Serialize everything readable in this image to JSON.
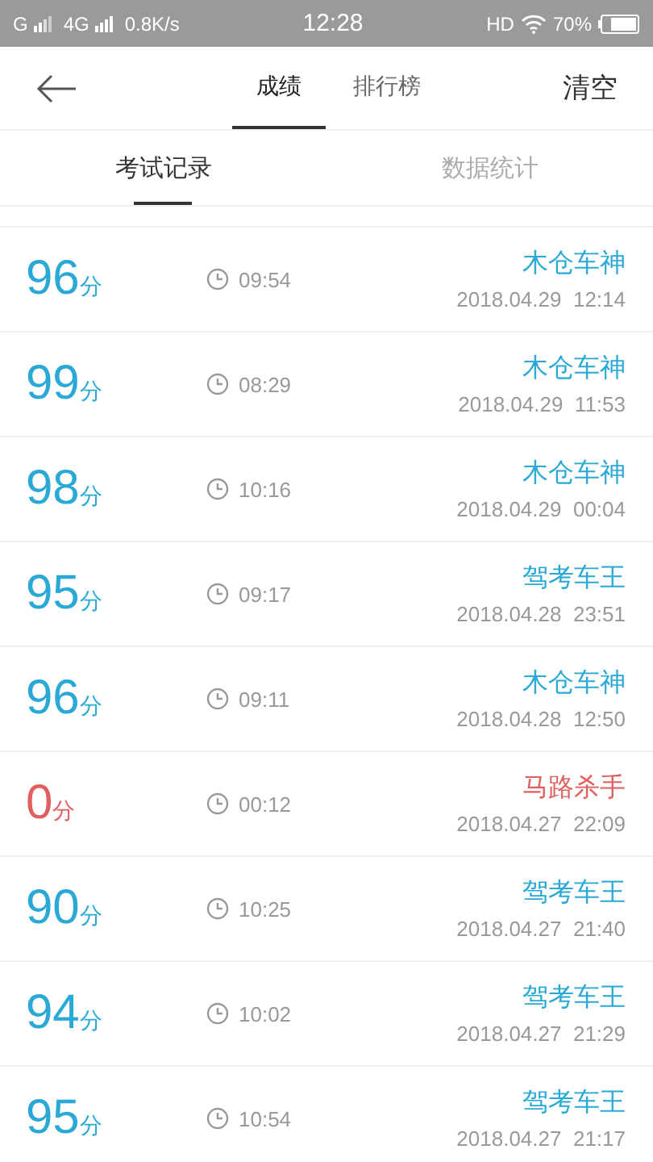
{
  "status_bar": {
    "carrier_1": "G",
    "carrier_2": "4G",
    "speed": "0.8K/s",
    "time": "12:28",
    "hd": "HD",
    "battery_text": "70%"
  },
  "header": {
    "tabs": [
      {
        "label": "成绩",
        "selected": true
      },
      {
        "label": "排行榜",
        "selected": false
      }
    ],
    "action": "清空"
  },
  "sub_tabs": [
    {
      "label": "考试记录",
      "selected": true
    },
    {
      "label": "数据统计",
      "selected": false
    }
  ],
  "records": [
    {
      "score": "96",
      "unit": "分",
      "failed": false,
      "duration": "09:54",
      "title": "木仓车神",
      "date": "2018.04.29  12:14"
    },
    {
      "score": "99",
      "unit": "分",
      "failed": false,
      "duration": "08:29",
      "title": "木仓车神",
      "date": "2018.04.29  11:53"
    },
    {
      "score": "98",
      "unit": "分",
      "failed": false,
      "duration": "10:16",
      "title": "木仓车神",
      "date": "2018.04.29  00:04"
    },
    {
      "score": "95",
      "unit": "分",
      "failed": false,
      "duration": "09:17",
      "title": "驾考车王",
      "date": "2018.04.28  23:51"
    },
    {
      "score": "96",
      "unit": "分",
      "failed": false,
      "duration": "09:11",
      "title": "木仓车神",
      "date": "2018.04.28  12:50"
    },
    {
      "score": "0",
      "unit": "分",
      "failed": true,
      "duration": "00:12",
      "title": "马路杀手",
      "date": "2018.04.27  22:09"
    },
    {
      "score": "90",
      "unit": "分",
      "failed": false,
      "duration": "10:25",
      "title": "驾考车王",
      "date": "2018.04.27  21:40"
    },
    {
      "score": "94",
      "unit": "分",
      "failed": false,
      "duration": "10:02",
      "title": "驾考车王",
      "date": "2018.04.27  21:29"
    },
    {
      "score": "95",
      "unit": "分",
      "failed": false,
      "duration": "10:54",
      "title": "驾考车王",
      "date": "2018.04.27  21:17"
    }
  ]
}
